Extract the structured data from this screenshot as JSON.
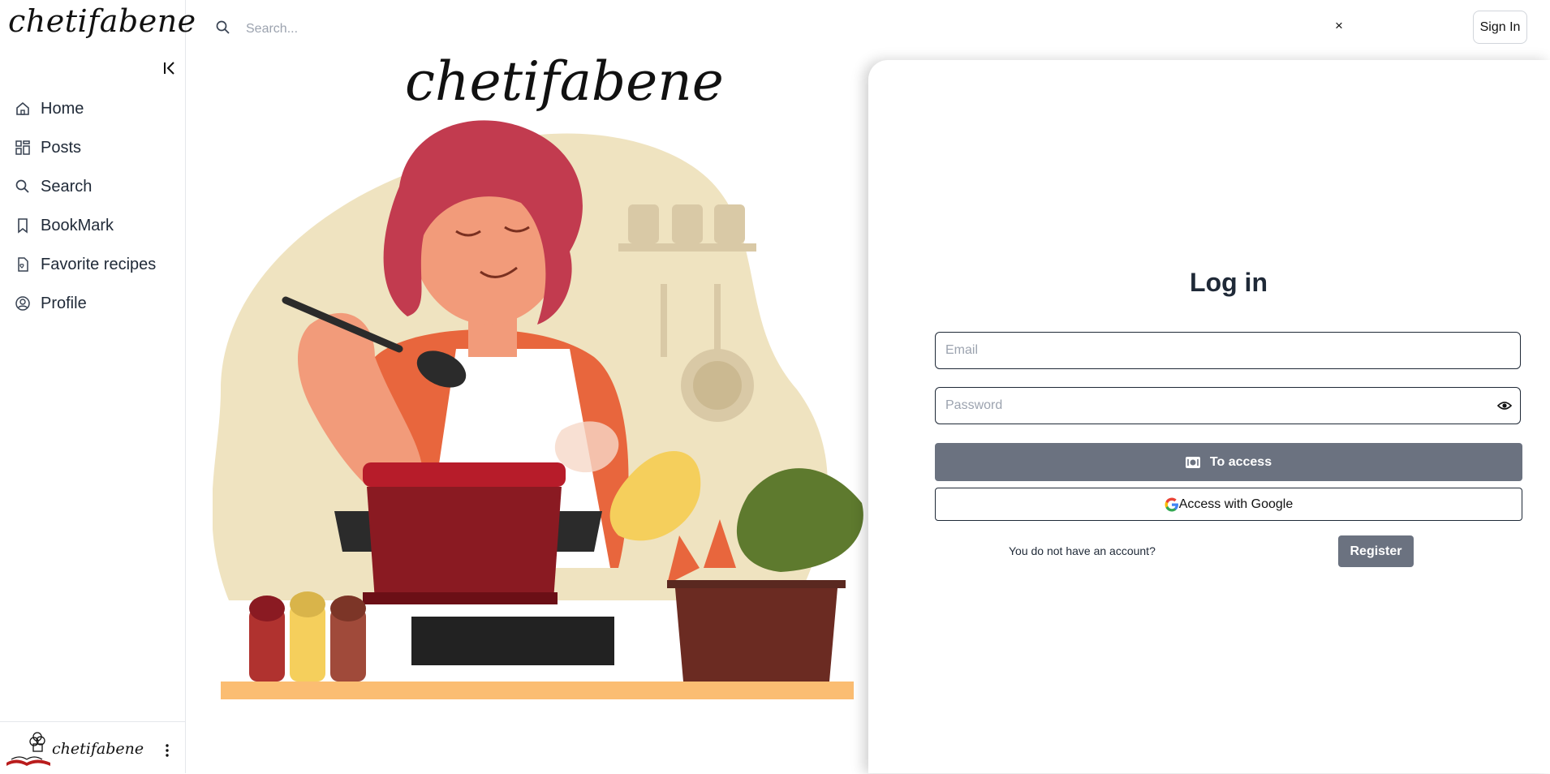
{
  "sidebar": {
    "logo": "chetifabene",
    "items": [
      {
        "label": "Home"
      },
      {
        "label": "Posts"
      },
      {
        "label": "Search"
      },
      {
        "label": "BookMark"
      },
      {
        "label": "Favorite recipes"
      },
      {
        "label": "Profile"
      }
    ],
    "footer_name": "chetifabene"
  },
  "header": {
    "search_placeholder": "Search...",
    "clear_label": "×",
    "signin_label": "Sign In"
  },
  "hero": {
    "title": "chetifabene"
  },
  "login": {
    "title": "Log in",
    "email_placeholder": "Email",
    "password_placeholder": "Password",
    "access_label": "To access",
    "google_label": "Access with Google",
    "no_account_text": "You do not have an account?",
    "register_label": "Register"
  },
  "colors": {
    "accent_gray": "#6b7280",
    "text_dark": "#1f2937"
  },
  "icons": {
    "nav": [
      "home-icon",
      "posts-grid-icon",
      "search-icon",
      "bookmark-icon",
      "favorite-recipes-icon",
      "profile-icon"
    ]
  }
}
